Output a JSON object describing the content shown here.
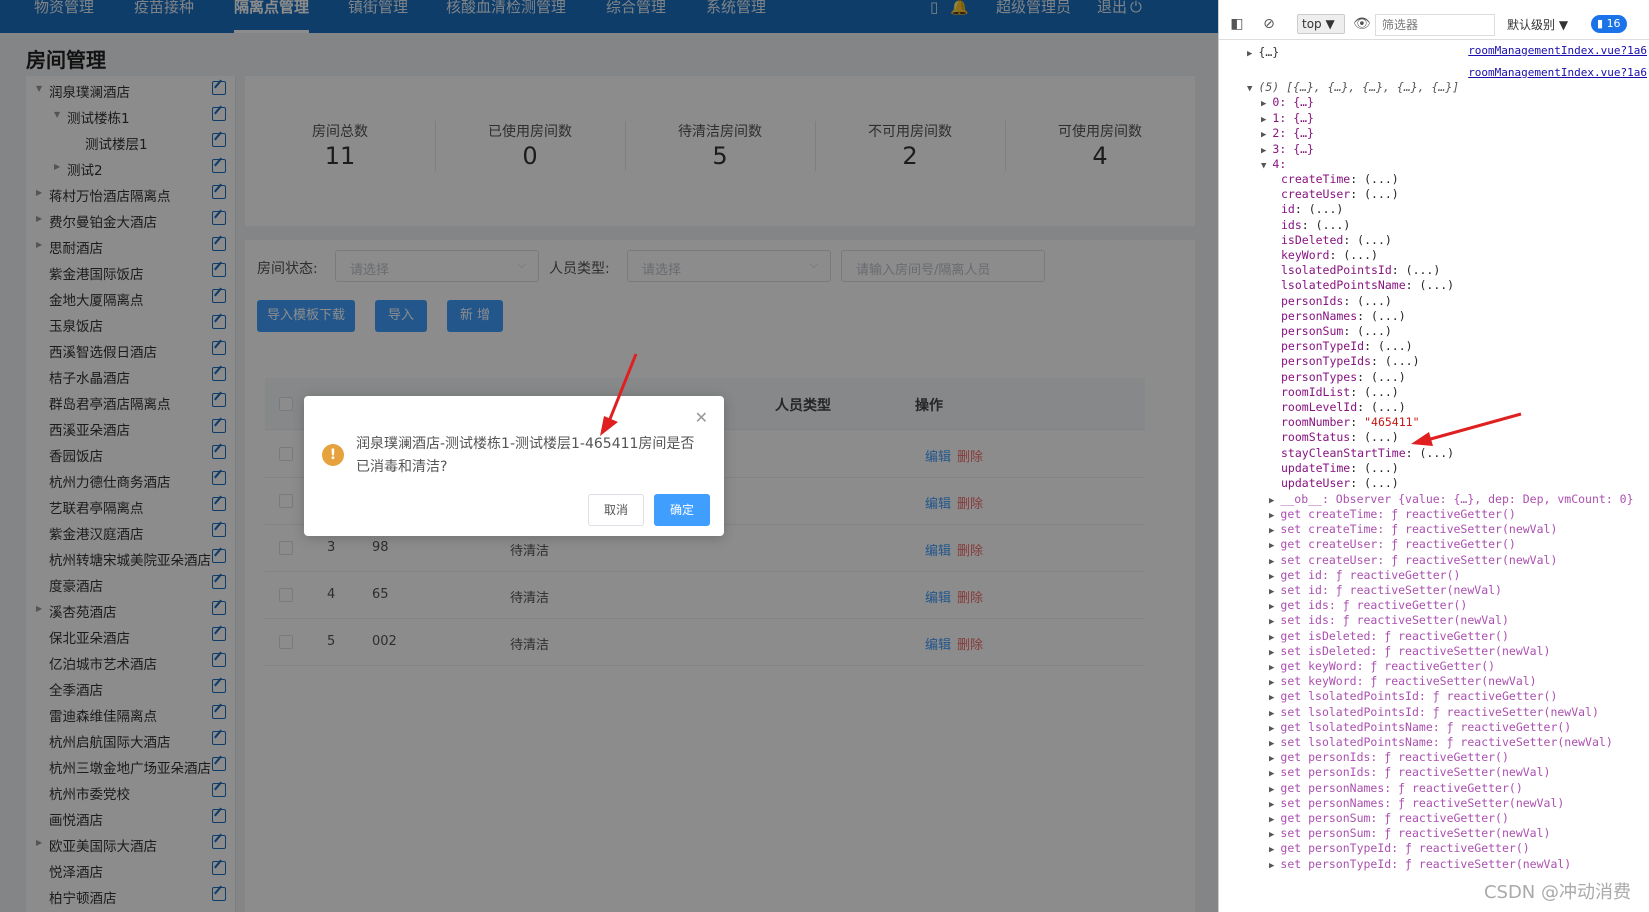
{
  "nav": {
    "items": [
      "物资管理",
      "疫苗接种",
      "隔离点管理",
      "镇街管理",
      "核酸血清检测管理",
      "综合管理",
      "系统管理"
    ],
    "active_index": 2,
    "user": "超级管理员",
    "logout": "退出",
    "notification_count": ""
  },
  "page": {
    "title": "房间管理"
  },
  "tree": [
    {
      "label": "润泉璞澜酒店",
      "level": 0,
      "expanded": true,
      "has_children": true
    },
    {
      "label": "测试楼栋1",
      "level": 1,
      "expanded": true,
      "has_children": true
    },
    {
      "label": "测试楼层1",
      "level": 2,
      "expanded": false,
      "has_children": false
    },
    {
      "label": "测试2",
      "level": 1,
      "expanded": false,
      "has_children": true
    },
    {
      "label": "蒋村万怡酒店隔离点",
      "level": 0,
      "expanded": false,
      "has_children": true
    },
    {
      "label": "费尔曼铂金大酒店",
      "level": 0,
      "expanded": false,
      "has_children": true
    },
    {
      "label": "思耐酒店",
      "level": 0,
      "expanded": false,
      "has_children": true
    },
    {
      "label": "紫金港国际饭店",
      "level": 0,
      "expanded": false,
      "has_children": false
    },
    {
      "label": "金地大厦隔离点",
      "level": 0,
      "expanded": false,
      "has_children": false
    },
    {
      "label": "玉泉饭店",
      "level": 0,
      "expanded": false,
      "has_children": false
    },
    {
      "label": "西溪智选假日酒店",
      "level": 0,
      "expanded": false,
      "has_children": false
    },
    {
      "label": "桔子水晶酒店",
      "level": 0,
      "expanded": false,
      "has_children": false
    },
    {
      "label": "群岛君亭酒店隔离点",
      "level": 0,
      "expanded": false,
      "has_children": false
    },
    {
      "label": "西溪亚朵酒店",
      "level": 0,
      "expanded": false,
      "has_children": false
    },
    {
      "label": "香园饭店",
      "level": 0,
      "expanded": false,
      "has_children": false
    },
    {
      "label": "杭州力德仕商务酒店",
      "level": 0,
      "expanded": false,
      "has_children": false
    },
    {
      "label": "艺联君亭隔离点",
      "level": 0,
      "expanded": false,
      "has_children": false
    },
    {
      "label": "紫金港汉庭酒店",
      "level": 0,
      "expanded": false,
      "has_children": false
    },
    {
      "label": "杭州转塘宋城美院亚朵酒店",
      "level": 0,
      "expanded": false,
      "has_children": false
    },
    {
      "label": "度豪酒店",
      "level": 0,
      "expanded": false,
      "has_children": false
    },
    {
      "label": "溪杏苑酒店",
      "level": 0,
      "expanded": false,
      "has_children": true
    },
    {
      "label": "保北亚朵酒店",
      "level": 0,
      "expanded": false,
      "has_children": false
    },
    {
      "label": "亿泊城市艺术酒店",
      "level": 0,
      "expanded": false,
      "has_children": false
    },
    {
      "label": "全季酒店",
      "level": 0,
      "expanded": false,
      "has_children": false
    },
    {
      "label": "雷迪森维佳隔离点",
      "level": 0,
      "expanded": false,
      "has_children": false
    },
    {
      "label": "杭州启航国际大酒店",
      "level": 0,
      "expanded": false,
      "has_children": false
    },
    {
      "label": "杭州三墩金地广场亚朵酒店",
      "level": 0,
      "expanded": false,
      "has_children": false
    },
    {
      "label": "杭州市委党校",
      "level": 0,
      "expanded": false,
      "has_children": false
    },
    {
      "label": "画悦酒店",
      "level": 0,
      "expanded": false,
      "has_children": false
    },
    {
      "label": "欧亚美国际大酒店",
      "level": 0,
      "expanded": false,
      "has_children": true
    },
    {
      "label": "悦泽酒店",
      "level": 0,
      "expanded": false,
      "has_children": false
    },
    {
      "label": "柏宁顿酒店",
      "level": 0,
      "expanded": false,
      "has_children": false
    }
  ],
  "stats": [
    {
      "label": "房间总数",
      "value": "11"
    },
    {
      "label": "已使用房间数",
      "value": "0"
    },
    {
      "label": "待清洁房间数",
      "value": "5"
    },
    {
      "label": "不可用房间数",
      "value": "2"
    },
    {
      "label": "可使用房间数",
      "value": "4"
    }
  ],
  "filters": {
    "room_status_label": "房间状态:",
    "room_status_placeholder": "请选择",
    "person_type_label": "人员类型:",
    "person_type_placeholder": "请选择",
    "search_placeholder": "请输入房间号/隔离人员"
  },
  "buttons": {
    "import_template": "导入模板下载",
    "import": "导入",
    "add": "新 增"
  },
  "table": {
    "headers": [
      "",
      "人员类型",
      "操作"
    ],
    "rows": [
      {
        "index": "",
        "room": "",
        "status": ""
      },
      {
        "index": "",
        "room": "",
        "status": ""
      },
      {
        "index": "3",
        "room": "98",
        "status": "待清洁"
      },
      {
        "index": "4",
        "room": "65",
        "status": "待清洁"
      },
      {
        "index": "5",
        "room": "002",
        "status": "待清洁"
      }
    ],
    "edit_label": "编辑",
    "delete_label": "删除"
  },
  "dialog": {
    "message": "润泉璞澜酒店-测试楼栋1-测试楼层1-465411房间是否已消毒和清洁?",
    "cancel": "取消",
    "confirm": "确定"
  },
  "devtools": {
    "context": "top",
    "filter_placeholder": "筛选器",
    "level": "默认级别",
    "message_count": "16",
    "source1": "roomManagementIndex.vue?1a6",
    "source2": "roomManagementIndex.vue?1a6",
    "collapsed_obj": "{…}",
    "array_summary": "(5) [{…}, {…}, {…}, {…}, {…}]",
    "items": [
      "0: {…}",
      "1: {…}",
      "2: {…}",
      "3: {…}"
    ],
    "item4_label": "4:",
    "props": [
      {
        "k": "createTime",
        "v": "(...)"
      },
      {
        "k": "createUser",
        "v": "(...)"
      },
      {
        "k": "id",
        "v": "(...)"
      },
      {
        "k": "ids",
        "v": "(...)"
      },
      {
        "k": "isDeleted",
        "v": "(...)"
      },
      {
        "k": "keyWord",
        "v": "(...)"
      },
      {
        "k": "lsolatedPointsId",
        "v": "(...)"
      },
      {
        "k": "lsolatedPointsName",
        "v": "(...)"
      },
      {
        "k": "personIds",
        "v": "(...)"
      },
      {
        "k": "personNames",
        "v": "(...)"
      },
      {
        "k": "personSum",
        "v": "(...)"
      },
      {
        "k": "personTypeId",
        "v": "(...)"
      },
      {
        "k": "personTypeIds",
        "v": "(...)"
      },
      {
        "k": "personTypes",
        "v": "(...)"
      },
      {
        "k": "roomIdList",
        "v": "(...)"
      },
      {
        "k": "roomLevelId",
        "v": "(...)"
      },
      {
        "k": "roomNumber",
        "v": "\"465411\""
      },
      {
        "k": "roomStatus",
        "v": "(...)"
      },
      {
        "k": "stayCleanStartTime",
        "v": "(...)"
      },
      {
        "k": "updateTime",
        "v": "(...)"
      },
      {
        "k": "updateUser",
        "v": "(...)"
      }
    ],
    "observer_line": "__ob__: Observer {value: {…}, dep: Dep, vmCount: 0}",
    "accessors": [
      "get createTime: ƒ reactiveGetter()",
      "set createTime: ƒ reactiveSetter(newVal)",
      "get createUser: ƒ reactiveGetter()",
      "set createUser: ƒ reactiveSetter(newVal)",
      "get id: ƒ reactiveGetter()",
      "set id: ƒ reactiveSetter(newVal)",
      "get ids: ƒ reactiveGetter()",
      "set ids: ƒ reactiveSetter(newVal)",
      "get isDeleted: ƒ reactiveGetter()",
      "set isDeleted: ƒ reactiveSetter(newVal)",
      "get keyWord: ƒ reactiveGetter()",
      "set keyWord: ƒ reactiveSetter(newVal)",
      "get lsolatedPointsId: ƒ reactiveGetter()",
      "set lsolatedPointsId: ƒ reactiveSetter(newVal)",
      "get lsolatedPointsName: ƒ reactiveGetter()",
      "set lsolatedPointsName: ƒ reactiveSetter(newVal)",
      "get personIds: ƒ reactiveGetter()",
      "set personIds: ƒ reactiveSetter(newVal)",
      "get personNames: ƒ reactiveGetter()",
      "set personNames: ƒ reactiveSetter(newVal)",
      "get personSum: ƒ reactiveGetter()",
      "set personSum: ƒ reactiveSetter(newVal)",
      "get personTypeId: ƒ reactiveGetter()",
      "set personTypeId: ƒ reactiveSetter(newVal)"
    ],
    "watermark": "CSDN @冲动消费"
  },
  "colors": {
    "nav_bg": "#1c6fbf",
    "primary": "#409eff",
    "danger": "#f56c6c",
    "warning": "#e6a23c",
    "annotation_arrow": "#e02020"
  }
}
